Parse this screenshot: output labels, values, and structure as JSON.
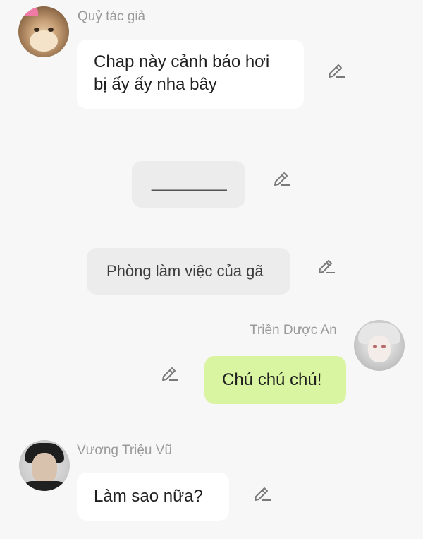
{
  "messages": [
    {
      "sender": "Quỷ tác giả",
      "text_line1": "Chap này cảnh báo hơi",
      "text_line2": "bị ấy ấy nha bây",
      "avatar_icon": "cat-avatar"
    },
    {
      "text": "________",
      "avatar_icon": null
    },
    {
      "text": "Phòng làm việc của gã",
      "avatar_icon": null
    },
    {
      "sender": "Triền Dược An",
      "text": "Chú chú chú!",
      "avatar_icon": "white-hair-avatar"
    },
    {
      "sender": "Vương Triệu Vũ",
      "text": "Làm sao nữa?",
      "avatar_icon": "dark-hair-avatar"
    }
  ],
  "icons": {
    "edit": "pencil-edit-icon"
  },
  "colors": {
    "background": "#f7f7f7",
    "bubble_white": "#ffffff",
    "bubble_gray": "#ececec",
    "bubble_green": "#d9f5a1",
    "sender_text": "#9a9a9a",
    "icon_stroke": "#7a7a7a"
  }
}
